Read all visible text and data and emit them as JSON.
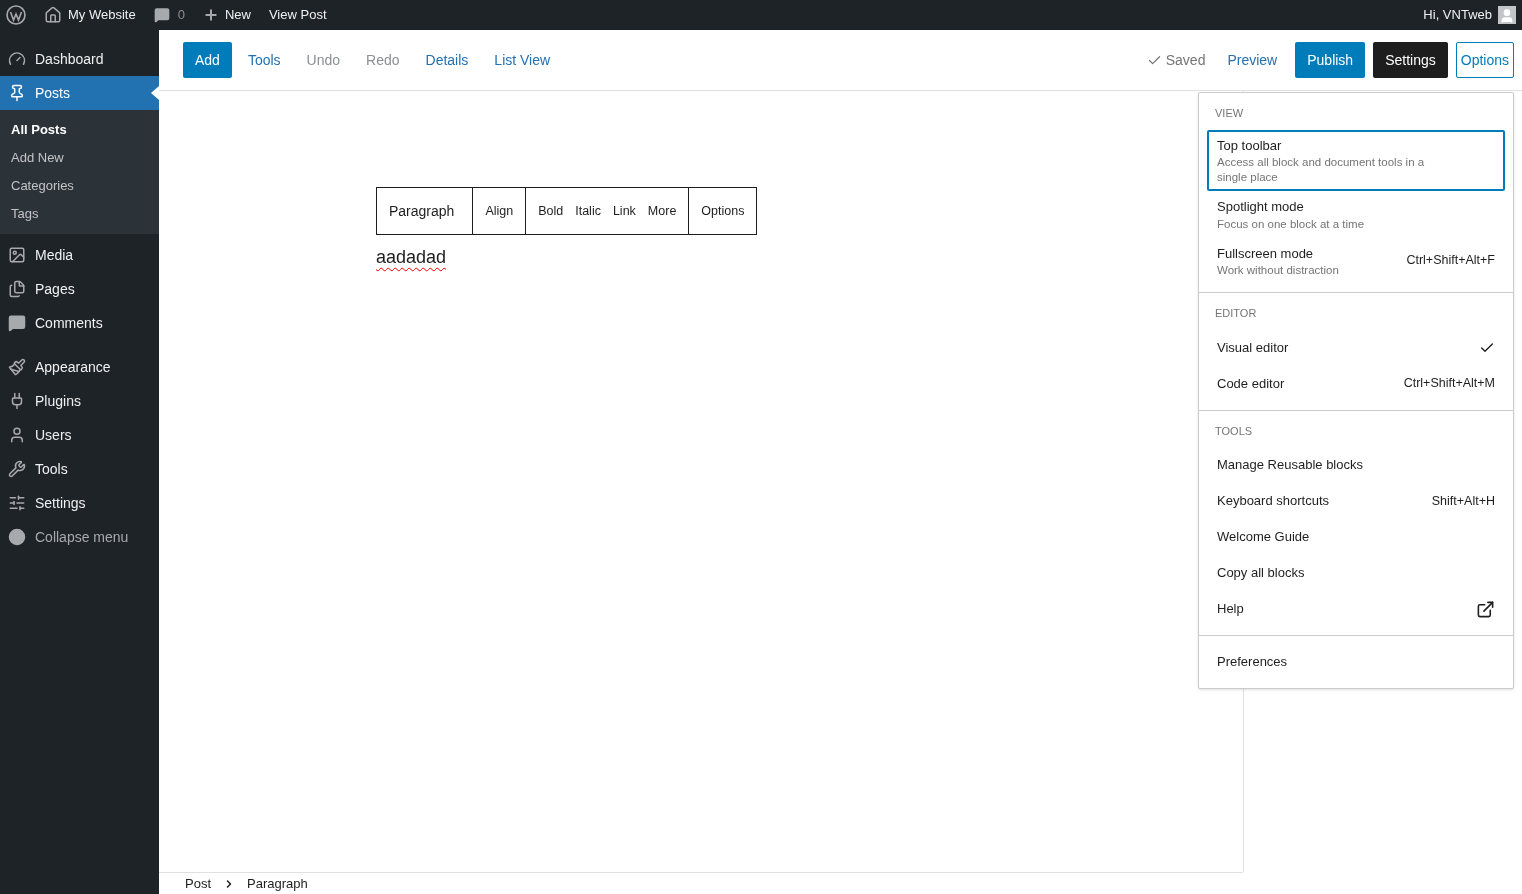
{
  "admin_bar": {
    "items": [
      {
        "kind": "logo"
      },
      {
        "kind": "home",
        "label": "My Website"
      },
      {
        "kind": "comments",
        "label": "0"
      },
      {
        "kind": "new",
        "label": "New"
      },
      {
        "kind": "link",
        "label": "View Post"
      }
    ],
    "greeting": "Hi, VNTweb"
  },
  "sidebar": {
    "items": [
      {
        "label": "Dashboard",
        "selected": false
      },
      {
        "label": "Posts",
        "selected": true,
        "children": [
          {
            "label": "All Posts",
            "selected": true
          },
          {
            "label": "Add New",
            "selected": false
          },
          {
            "label": "Categories",
            "selected": false
          },
          {
            "label": "Tags",
            "selected": false
          }
        ]
      },
      {
        "label": "Media",
        "selected": false
      },
      {
        "label": "Pages",
        "selected": false
      },
      {
        "label": "Comments",
        "selected": false
      },
      {
        "label": "Appearance",
        "selected": false
      },
      {
        "label": "Plugins",
        "selected": false
      },
      {
        "label": "Users",
        "selected": false
      },
      {
        "label": "Tools",
        "selected": false
      },
      {
        "label": "Settings",
        "selected": false
      },
      {
        "label": "Collapse menu",
        "selected": false
      }
    ]
  },
  "header": {
    "left": [
      {
        "label": "Add",
        "kind": "primary"
      },
      {
        "label": "Tools",
        "kind": "link",
        "disabled": false
      },
      {
        "label": "Undo",
        "kind": "link",
        "disabled": true
      },
      {
        "label": "Redo",
        "kind": "link",
        "disabled": true
      },
      {
        "label": "Details",
        "kind": "link",
        "disabled": false
      },
      {
        "label": "List View",
        "kind": "link",
        "disabled": false
      }
    ],
    "status": "Saved",
    "right": [
      {
        "label": "Preview",
        "kind": "link"
      },
      {
        "label": "Publish",
        "kind": "primary"
      },
      {
        "label": "Settings",
        "kind": "toggle",
        "pressed": true
      },
      {
        "label": "Options",
        "kind": "outline",
        "pressed": true
      }
    ]
  },
  "editor": {
    "block_toolbar": [
      [
        "Paragraph"
      ],
      [
        "Align"
      ],
      [
        "Bold",
        "Italic",
        "Link",
        "More"
      ],
      [
        "Options"
      ]
    ],
    "paragraph": "aadadad"
  },
  "options_menu": {
    "sections": [
      {
        "label": "VIEW",
        "items": [
          {
            "title": "Top toolbar",
            "description": "Access all block and document tools in a single place",
            "focused": true
          },
          {
            "title": "Spotlight mode",
            "description": "Focus on one block at a time",
            "focused": false
          },
          {
            "title": "Fullscreen mode",
            "description": "Work without distraction",
            "shortcut": "Ctrl+Shift+Alt+F",
            "focused": false
          }
        ]
      },
      {
        "label": "EDITOR",
        "items": [
          {
            "title": "Visual editor",
            "checked": true,
            "focused": false
          },
          {
            "title": "Code editor",
            "checked": false,
            "shortcut": "Ctrl+Shift+Alt+M",
            "focused": false
          }
        ]
      },
      {
        "label": "TOOLS",
        "items": [
          {
            "title": "Manage Reusable blocks",
            "focused": false
          },
          {
            "title": "Keyboard shortcuts",
            "shortcut": "Shift+Alt+H",
            "focused": false
          },
          {
            "title": "Welcome Guide",
            "focused": false
          },
          {
            "title": "Copy all blocks",
            "focused": false
          },
          {
            "title": "Help",
            "kind": "external",
            "focused": false
          }
        ]
      },
      {
        "items": [
          {
            "title": "Preferences",
            "focused": false
          }
        ]
      }
    ]
  },
  "breadcrumb": [
    "Post",
    "Paragraph"
  ]
}
